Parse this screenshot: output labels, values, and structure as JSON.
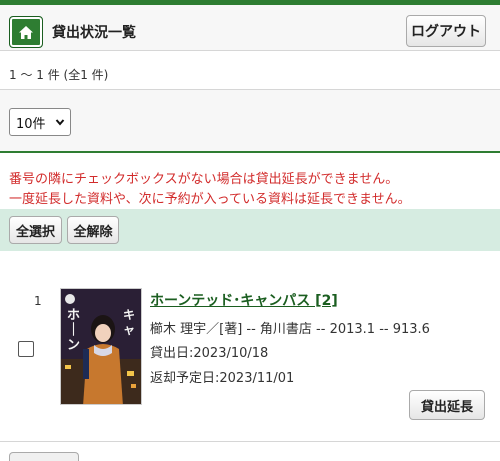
{
  "header": {
    "title": "貸出状況一覧",
    "logout_label": "ログアウト",
    "accent_color": "#2e7d32"
  },
  "results": {
    "count_text": "1 ～ 1 件 (全1 件)"
  },
  "per_page": {
    "selected": "10件"
  },
  "notice": {
    "line1": "番号の隣にチェックボックスがない場合は貸出延長ができません。",
    "line2": "一度延長した資料や、次に予約が入っている資料は延長できません。",
    "color": "#d22c2c"
  },
  "bulk_actions": {
    "select_all_label": "全選択",
    "clear_all_label": "全解除"
  },
  "items": [
    {
      "number": "1",
      "title": "ホーンテッド･キャンパス [2]",
      "meta": "櫛木 理宇／[著] -- 角川書店 -- 2013.1 -- 913.6",
      "loan_date": "貸出日:2023/10/18",
      "due_date": "返却予定日:2023/11/01",
      "extend_label": "貸出延長",
      "checked": false
    }
  ]
}
